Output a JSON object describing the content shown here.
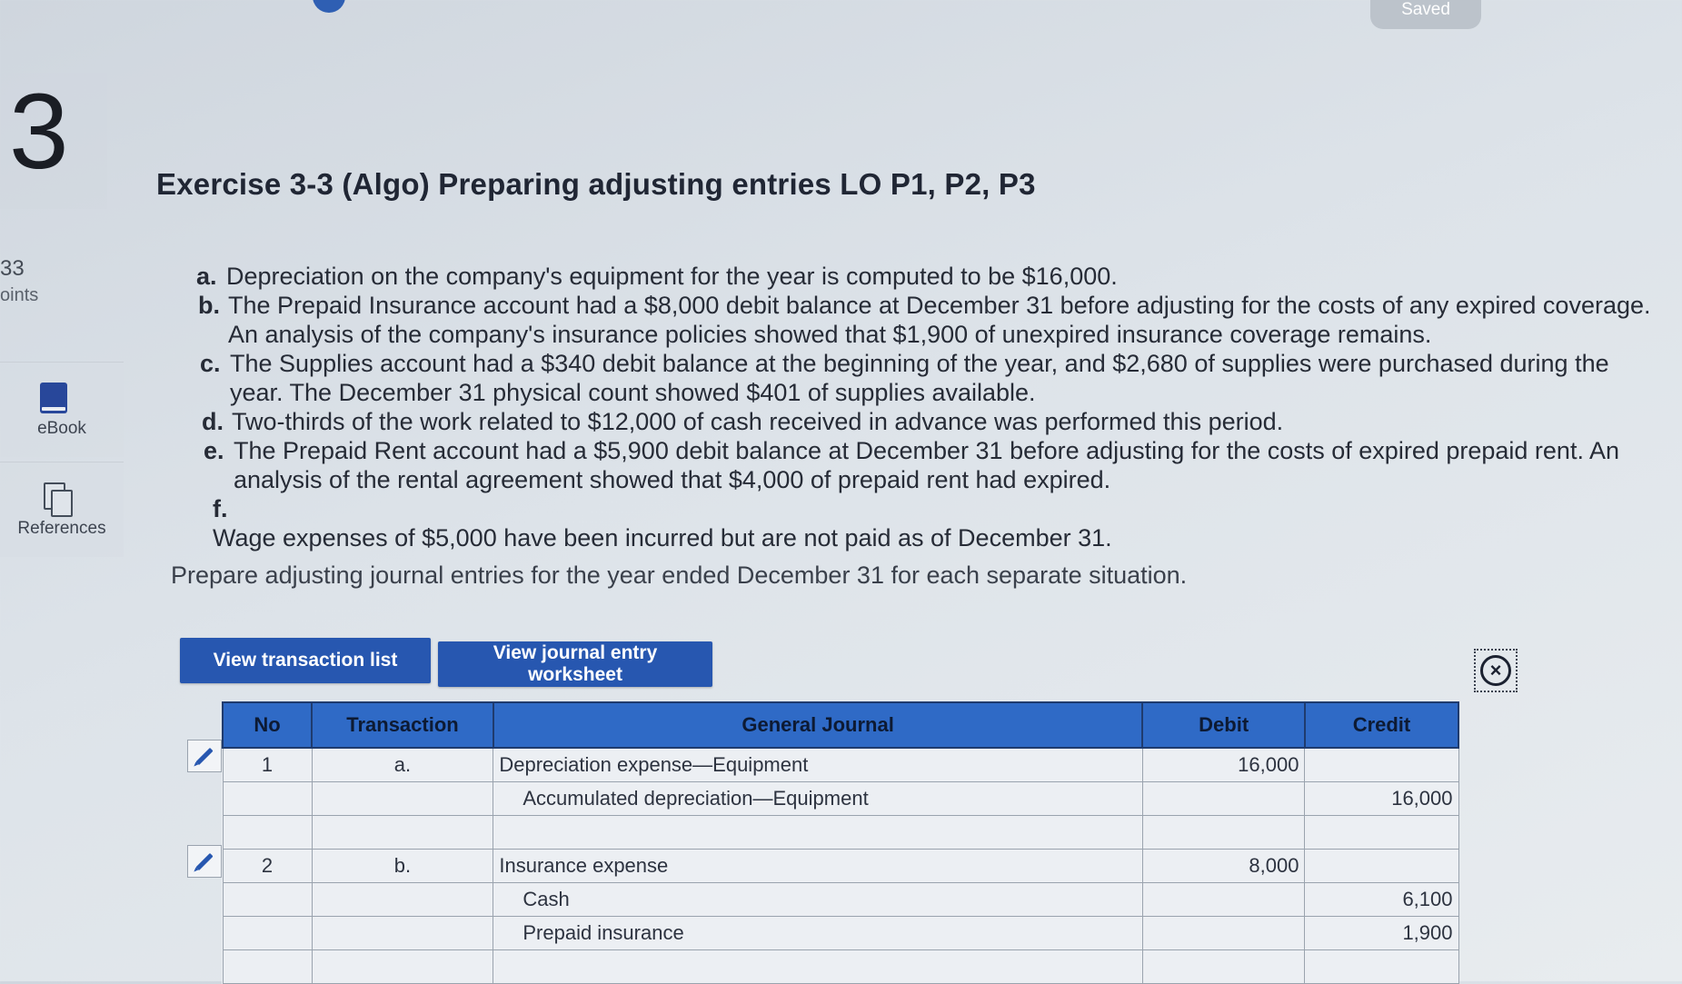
{
  "header": {
    "saved_label": "Saved"
  },
  "question": {
    "number": "3",
    "points_value": "33",
    "points_label": "oints"
  },
  "sidebar": {
    "ebook_label": "eBook",
    "references_label": "References"
  },
  "exercise": {
    "title": "Exercise 3-3 (Algo) Preparing adjusting entries LO P1, P2, P3",
    "items": [
      {
        "marker": "a.",
        "text": "Depreciation on the company's equipment for the year is computed to be $16,000."
      },
      {
        "marker": "b.",
        "text": "The Prepaid Insurance account had a $8,000 debit balance at December 31 before adjusting for the costs of any expired coverage. An analysis of the company's insurance policies showed that $1,900 of unexpired insurance coverage remains."
      },
      {
        "marker": "c.",
        "text": "The Supplies account had a $340 debit balance at the beginning of the year, and $2,680 of supplies were purchased during the year. The December 31 physical count showed $401 of supplies available."
      },
      {
        "marker": "d.",
        "text": "Two-thirds of the work related to $12,000 of cash received in advance was performed this period."
      },
      {
        "marker": "e.",
        "text": "The Prepaid Rent account had a $5,900 debit balance at December 31 before adjusting for the costs of expired prepaid rent. An analysis of the rental agreement showed that $4,000 of prepaid rent had expired."
      },
      {
        "marker": "f.",
        "text": "Wage expenses of $5,000 have been incurred but are not paid as of December 31."
      }
    ],
    "instruction": "Prepare adjusting journal entries for the year ended December 31 for each separate situation."
  },
  "buttons": {
    "view_transactions": "View transaction list",
    "view_worksheet": "View journal entry worksheet"
  },
  "table": {
    "headers": {
      "no": "No",
      "transaction": "Transaction",
      "journal": "General Journal",
      "debit": "Debit",
      "credit": "Credit"
    },
    "rows": [
      {
        "no": "1",
        "transaction": "a.",
        "account": "Depreciation expense—Equipment",
        "debit": "16,000",
        "credit": ""
      },
      {
        "no": "",
        "transaction": "",
        "account": "Accumulated depreciation—Equipment",
        "debit": "",
        "credit": "16,000"
      },
      {
        "no": "",
        "transaction": "",
        "account": "",
        "debit": "",
        "credit": ""
      },
      {
        "no": "2",
        "transaction": "b.",
        "account": "Insurance expense",
        "debit": "8,000",
        "credit": ""
      },
      {
        "no": "",
        "transaction": "",
        "account": "Cash",
        "debit": "",
        "credit": "6,100"
      },
      {
        "no": "",
        "transaction": "",
        "account": "Prepaid insurance",
        "debit": "",
        "credit": "1,900"
      },
      {
        "no": "",
        "transaction": "",
        "account": "",
        "debit": "",
        "credit": ""
      }
    ]
  },
  "colors": {
    "accent": "#2757b0",
    "header_bg": "#2f6ac6"
  }
}
